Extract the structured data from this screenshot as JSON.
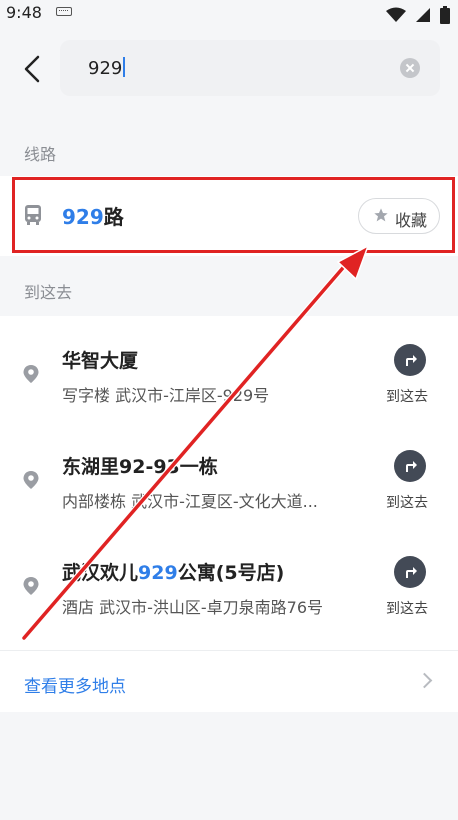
{
  "status_bar": {
    "time": "9:48"
  },
  "search": {
    "query": "929"
  },
  "sections": {
    "routes": "线路",
    "goto": "到这去"
  },
  "route": {
    "number": "929",
    "suffix": "路",
    "favorite_label": "收藏"
  },
  "places": [
    {
      "title_pre": "华智大厦",
      "title_hl": "",
      "title_post": "",
      "subtitle": "写字楼 武汉市-江岸区-929号",
      "action": "到这去"
    },
    {
      "title_pre": "东湖里92-93一栋",
      "title_hl": "",
      "title_post": "",
      "subtitle": "内部楼栋 武汉市-江夏区-文化大道...",
      "action": "到这去"
    },
    {
      "title_pre": "武汉欢儿",
      "title_hl": "929",
      "title_post": "公寓(5号店)",
      "subtitle": "酒店 武汉市-洪山区-卓刀泉南路76号",
      "action": "到这去"
    }
  ],
  "more": {
    "label": "查看更多地点"
  },
  "colors": {
    "accent": "#2f7ee8",
    "highlight_box": "#e02323",
    "annotation_arrow": "#e02323",
    "action_circle": "#434a56"
  },
  "icons": [
    "keyboard-icon",
    "wifi-icon",
    "signal-icon",
    "battery-icon",
    "back-arrow-icon",
    "clear-icon",
    "bus-icon",
    "star-icon",
    "location-pin-icon",
    "turn-right-arrow-icon",
    "chevron-right-icon"
  ]
}
